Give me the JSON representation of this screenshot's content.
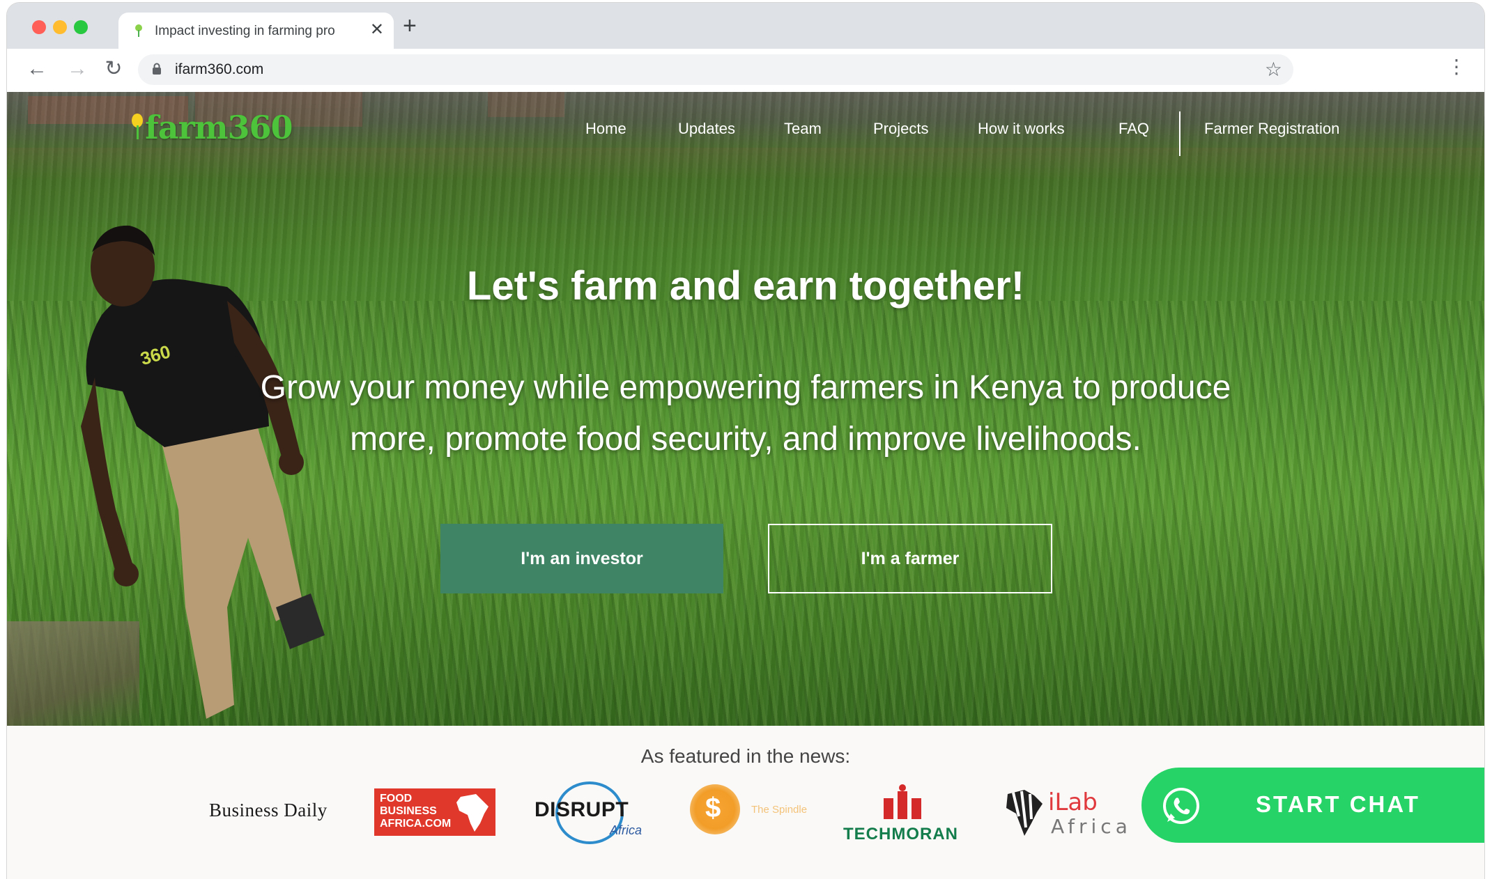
{
  "browser": {
    "tab_title": "Impact investing in farming pro",
    "tab_close": "✕",
    "new_tab": "+",
    "url": "ifarm360.com"
  },
  "site": {
    "logo_text": "farm360",
    "nav": [
      "Home",
      "Updates",
      "Team",
      "Projects",
      "How it works",
      "FAQ",
      "Farmer Registration"
    ]
  },
  "hero": {
    "headline": "Let's farm and earn together!",
    "subheadline": "Grow your money while empowering farmers in Kenya to produce more, promote food security, and improve livelihoods.",
    "investor_button": "I'm an investor",
    "farmer_button": "I'm a farmer",
    "shirt_text": "360"
  },
  "press": {
    "heading": "As featured in the news:",
    "logos": {
      "business_daily": "Business Daily",
      "fba_line1": "FOOD",
      "fba_line2": "BUSINESS",
      "fba_line3": "AFRICA.COM",
      "disrupt": "DISRUPT",
      "disrupt_sub": "Africa",
      "spindle": "The Spindle",
      "techmoran": "TECHMORAN",
      "ilab_top": "iLab",
      "ilab_bottom": "Africa"
    }
  },
  "chat": {
    "label": "START CHAT"
  },
  "colors": {
    "brand_green": "#4cc33a",
    "investor_button": "#3e8465",
    "whatsapp": "#25d366"
  }
}
